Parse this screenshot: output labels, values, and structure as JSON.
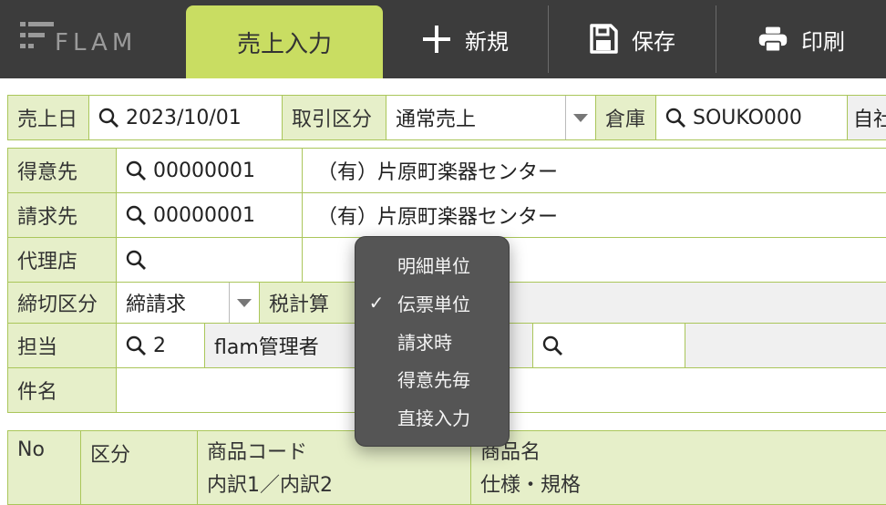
{
  "app": {
    "logo_text": "FLAM",
    "active_tab": "売上入力",
    "toolbar": {
      "new_label": "新規",
      "save_label": "保存",
      "print_label": "印刷"
    }
  },
  "header_row": {
    "sales_date_label": "売上日",
    "sales_date_value": "2023/10/01",
    "trade_type_label": "取引区分",
    "trade_type_value": "通常売上",
    "warehouse_label": "倉庫",
    "warehouse_value": "SOUKO000",
    "own_label": "自社"
  },
  "form": {
    "customer_label": "得意先",
    "customer_code": "00000001",
    "customer_name": "（有）片原町楽器センター",
    "billing_label": "請求先",
    "billing_code": "00000001",
    "billing_name": "（有）片原町楽器センター",
    "agent_label": "代理店",
    "closing_label": "締切区分",
    "closing_value": "締請求",
    "tax_calc_label": "税計算",
    "staff_label": "担当",
    "staff_code": "2",
    "staff_name": "flam管理者",
    "subject_label": "件名"
  },
  "tax_menu": {
    "items": [
      "明細単位",
      "伝票単位",
      "請求時",
      "得意先毎",
      "直接入力"
    ],
    "selected": "伝票単位",
    "check_mark": "✓"
  },
  "detail_header": {
    "no": "No",
    "kubun": "区分",
    "product_code": "商品コード",
    "breakdown": "内訳1／内訳2",
    "product_name": "商品名",
    "spec": "仕様・規格"
  }
}
